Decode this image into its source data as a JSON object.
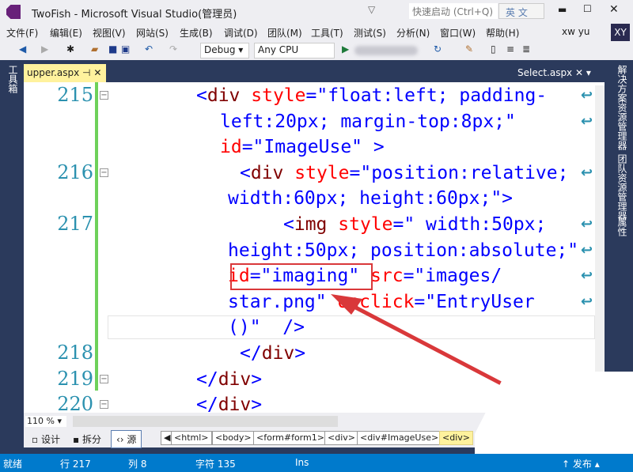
{
  "window": {
    "title": "TwoFish - Microsoft Visual Studio(管理员)",
    "quick_launch": "快速启动 (Ctrl+Q)",
    "ime": "英 文",
    "user": "xw yu",
    "avatar": "XY"
  },
  "menu": [
    "文件(F)",
    "编辑(E)",
    "视图(V)",
    "网站(S)",
    "生成(B)",
    "调试(D)",
    "团队(M)",
    "工具(T)",
    "测试(S)",
    "分析(N)",
    "窗口(W)",
    "帮助(H)"
  ],
  "toolbar": {
    "config": "Debug",
    "platform": "Any CPU"
  },
  "tabs": {
    "active": "upper.aspx",
    "other": "Select.aspx"
  },
  "side_panels": {
    "left": "工具箱",
    "right": [
      "解决方案资源管理器",
      "团队资源管理器",
      "属性"
    ]
  },
  "code": {
    "line_numbers": [
      "215",
      "216",
      "217",
      "218",
      "219",
      "220"
    ],
    "rows": [
      [
        [
          "b",
          "<"
        ],
        [
          "t",
          "div "
        ],
        [
          "a",
          "style"
        ],
        [
          "b",
          "=\"float:left; padding-"
        ]
      ],
      [
        [
          "b",
          "left:20px; margin-top:8px;\""
        ]
      ],
      [
        [
          "a",
          "id"
        ],
        [
          "b",
          "=\"ImageUse\" >"
        ]
      ],
      [
        [
          "b",
          "<"
        ],
        [
          "t",
          "div "
        ],
        [
          "a",
          "style"
        ],
        [
          "b",
          "=\"position:relative;"
        ]
      ],
      [
        [
          "b",
          "width:60px; height:60px;\">"
        ]
      ],
      [
        [
          "b",
          "<"
        ],
        [
          "t",
          "img "
        ],
        [
          "a",
          "style"
        ],
        [
          "b",
          "=\" width:50px;"
        ]
      ],
      [
        [
          "b",
          "height:50px; position:absolute;\""
        ]
      ],
      [
        [
          "a",
          "id"
        ],
        [
          "b",
          "=\"imaging\" "
        ],
        [
          "a",
          "src"
        ],
        [
          "b",
          "=\"images/"
        ]
      ],
      [
        [
          "b",
          "star.png\" "
        ],
        [
          "a",
          "onclick"
        ],
        [
          "b",
          "=\"EntryUser"
        ]
      ],
      [
        [
          "b",
          "()\"  />"
        ]
      ],
      [
        [
          "b",
          "</"
        ],
        [
          "t",
          "div"
        ],
        [
          "b",
          ">"
        ]
      ],
      [
        [
          "b",
          "</"
        ],
        [
          "t",
          "div"
        ],
        [
          "b",
          ">"
        ]
      ],
      [
        [
          "b",
          "</"
        ],
        [
          "t",
          "div"
        ],
        [
          "b",
          ">"
        ]
      ]
    ]
  },
  "zoom": "110 %",
  "views": {
    "design": "设计",
    "split": "拆分",
    "source": "源"
  },
  "breadcrumbs": [
    "<html>",
    "<body>",
    "<form#form1>",
    "<div>",
    "<div#ImageUse>",
    "<div>"
  ],
  "status": {
    "ready": "就绪",
    "line": "行 217",
    "col": "列 8",
    "char": "字符 135",
    "mode": "Ins",
    "publish": "发布"
  },
  "colors": {
    "status": "#007acc",
    "highlight": "#d9383a",
    "tab": "#fff29d"
  }
}
